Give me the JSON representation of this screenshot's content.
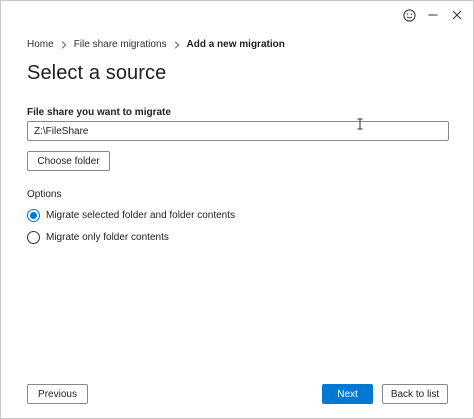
{
  "titlebar": {
    "icons": [
      "smiley-feedback-icon",
      "minimize-icon",
      "close-icon"
    ]
  },
  "breadcrumb": {
    "items": [
      "Home",
      "File share migrations",
      "Add a new migration"
    ],
    "separator_icon": "chevron-right-icon"
  },
  "page": {
    "title": "Select a source"
  },
  "source": {
    "label": "File share you want to migrate",
    "value": "Z:\\FileShare",
    "choose_button": "Choose folder"
  },
  "options": {
    "label": "Options",
    "choices": [
      {
        "label": "Migrate selected folder and folder contents",
        "selected": true
      },
      {
        "label": "Migrate only folder contents",
        "selected": false
      }
    ]
  },
  "footer": {
    "previous": "Previous",
    "next": "Next",
    "back_to_list": "Back to list"
  },
  "colors": {
    "accent": "#0078d4",
    "border": "#8a8886",
    "text": "#201f1e"
  }
}
